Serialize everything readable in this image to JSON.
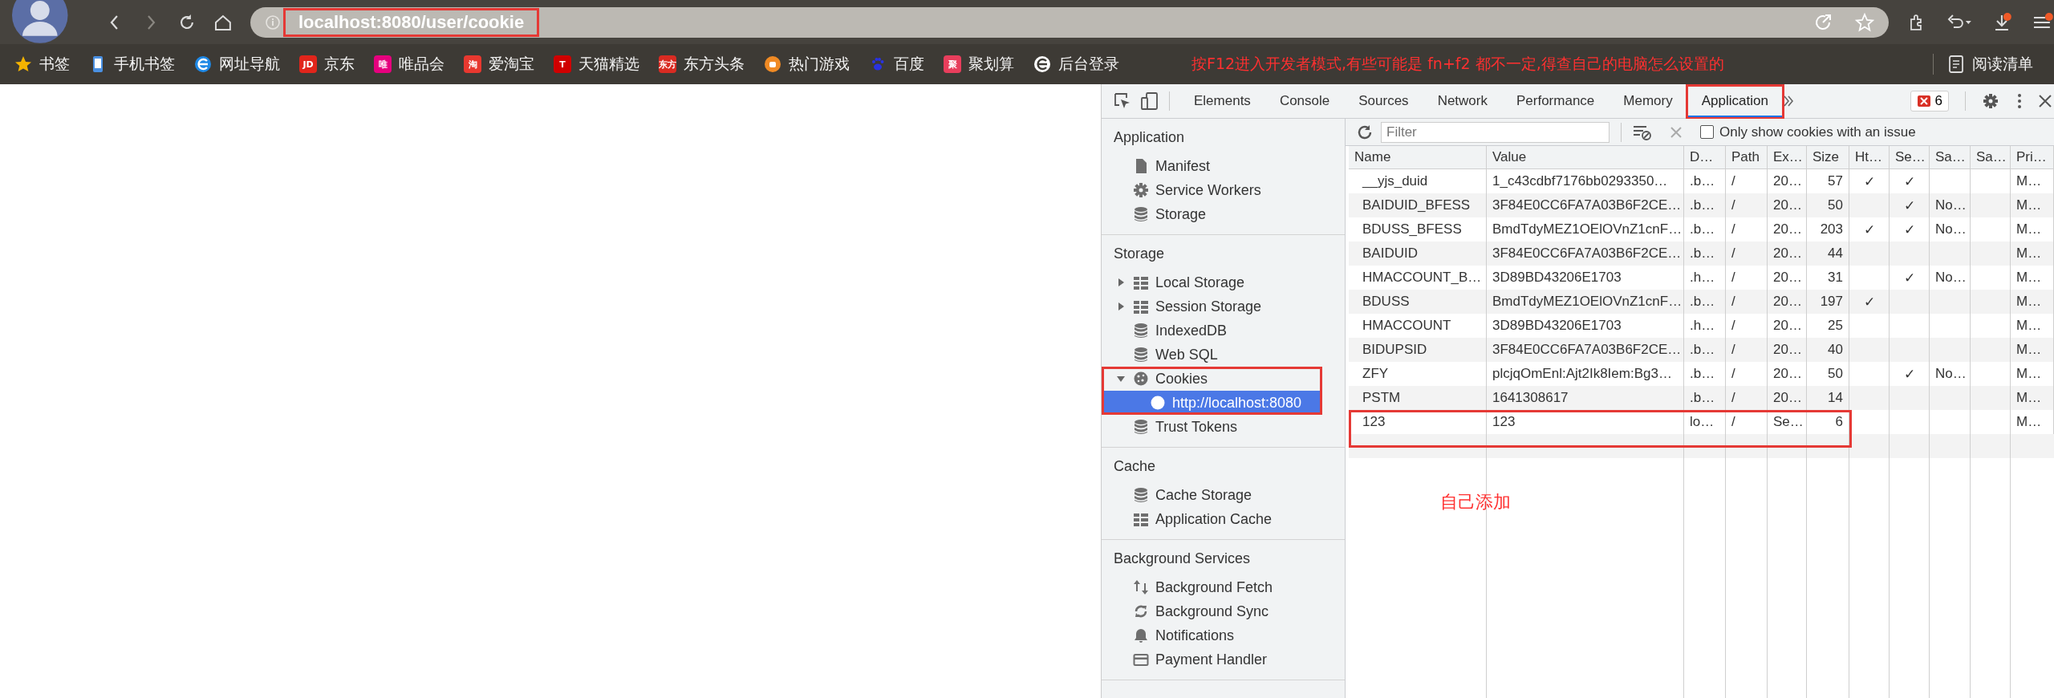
{
  "browser": {
    "url": "localhost:8080/user/cookie",
    "url_annotated": true,
    "bookmarks": [
      {
        "label": "书签",
        "kind": "star",
        "color": "#f5b400"
      },
      {
        "label": "手机书签",
        "kind": "phone",
        "color": "#4a90e2"
      },
      {
        "label": "网址导航",
        "kind": "globe",
        "color": "#1e88e5"
      },
      {
        "label": "京东",
        "kind": "text",
        "icon_text": "JD",
        "color": "#e1251b"
      },
      {
        "label": "唯品会",
        "kind": "text",
        "icon_text": "唯",
        "color": "#e6007e"
      },
      {
        "label": "爱淘宝",
        "kind": "text",
        "icon_text": "淘",
        "color": "#e8382f"
      },
      {
        "label": "天猫精选",
        "kind": "text",
        "icon_text": "T",
        "color": "#d00000"
      },
      {
        "label": "东方头条",
        "kind": "text",
        "icon_text": "东方",
        "color": "#d92b22"
      },
      {
        "label": "热门游戏",
        "kind": "circle",
        "color": "#f08a24"
      },
      {
        "label": "百度",
        "kind": "paw",
        "color": "#2932e1"
      },
      {
        "label": "聚划算",
        "kind": "text",
        "icon_text": "聚",
        "color": "#e83e5c"
      },
      {
        "label": "后台登录",
        "kind": "globe",
        "color": "#ffffff"
      }
    ],
    "annotation": "按F12进入开发者模式,有些可能是 fn+f2 都不一定,得查自己的电脑怎么设置的",
    "reading_list": "阅读清单"
  },
  "devtools": {
    "tabs": [
      {
        "label": "Elements",
        "selected": false,
        "annotated": false
      },
      {
        "label": "Console",
        "selected": false,
        "annotated": false
      },
      {
        "label": "Sources",
        "selected": false,
        "annotated": false
      },
      {
        "label": "Network",
        "selected": false,
        "annotated": false
      },
      {
        "label": "Performance",
        "selected": false,
        "annotated": false
      },
      {
        "label": "Memory",
        "selected": false,
        "annotated": false
      },
      {
        "label": "Application",
        "selected": true,
        "annotated": true
      }
    ],
    "error_count": "6",
    "sidebar": [
      {
        "title": "Application",
        "items": [
          {
            "label": "Manifest",
            "kind": "file",
            "selected": false
          },
          {
            "label": "Service Workers",
            "kind": "gear",
            "selected": false
          },
          {
            "label": "Storage",
            "kind": "db",
            "selected": false
          }
        ]
      },
      {
        "title": "Storage",
        "items": [
          {
            "label": "Local Storage",
            "kind": "table",
            "selected": false,
            "expanded": false
          },
          {
            "label": "Session Storage",
            "kind": "table",
            "selected": false,
            "expanded": false
          },
          {
            "label": "IndexedDB",
            "kind": "db",
            "selected": false
          },
          {
            "label": "Web SQL",
            "kind": "db",
            "selected": false
          },
          {
            "label": "Cookies",
            "kind": "cookie",
            "selected": false,
            "expanded": true,
            "annotated": true,
            "children": [
              {
                "label": "http://localhost:8080",
                "kind": "cookie",
                "selected": true
              }
            ]
          },
          {
            "label": "Trust Tokens",
            "kind": "db",
            "selected": false
          }
        ]
      },
      {
        "title": "Cache",
        "items": [
          {
            "label": "Cache Storage",
            "kind": "db",
            "selected": false
          },
          {
            "label": "Application Cache",
            "kind": "table",
            "selected": false
          }
        ]
      },
      {
        "title": "Background Services",
        "items": [
          {
            "label": "Background Fetch",
            "kind": "arrows",
            "selected": false
          },
          {
            "label": "Background Sync",
            "kind": "sync",
            "selected": false
          },
          {
            "label": "Notifications",
            "kind": "bell",
            "selected": false
          },
          {
            "label": "Payment Handler",
            "kind": "card",
            "selected": false
          }
        ]
      }
    ],
    "filter_placeholder": "Filter",
    "issue_filter": {
      "label": "Only show cookies with an issue",
      "checked": false
    },
    "table": {
      "columns": [
        "Name",
        "Value",
        "D…",
        "Path",
        "Ex…",
        "Size",
        "Ht…",
        "Se…",
        "Sa…",
        "Sa…",
        "Pri…"
      ],
      "rows": [
        {
          "cells": [
            "__yjs_duid",
            "1_c43cdbf7176bb0293350…",
            ".b…",
            "/",
            "20…",
            "57",
            "✓",
            "✓",
            null,
            null,
            "M…"
          ]
        },
        {
          "cells": [
            "BAIDUID_BFESS",
            "3F84E0CC6FA7A03B6F2CE…",
            ".b…",
            "/",
            "20…",
            "50",
            null,
            "✓",
            "No…",
            null,
            "M…"
          ]
        },
        {
          "cells": [
            "BDUSS_BFESS",
            "BmdTdyMEZ1OElOVnZ1cnF…",
            ".b…",
            "/",
            "20…",
            "203",
            "✓",
            "✓",
            "No…",
            null,
            "M…"
          ]
        },
        {
          "cells": [
            "BAIDUID",
            "3F84E0CC6FA7A03B6F2CE…",
            ".b…",
            "/",
            "20…",
            "44",
            null,
            null,
            null,
            null,
            "M…"
          ]
        },
        {
          "cells": [
            "HMACCOUNT_B…",
            "3D89BD43206E1703",
            ".h…",
            "/",
            "20…",
            "31",
            null,
            "✓",
            "No…",
            null,
            "M…"
          ]
        },
        {
          "cells": [
            "BDUSS",
            "BmdTdyMEZ1OElOVnZ1cnF…",
            ".b…",
            "/",
            "20…",
            "197",
            "✓",
            null,
            null,
            null,
            "M…"
          ]
        },
        {
          "cells": [
            "HMACCOUNT",
            "3D89BD43206E1703",
            ".h…",
            "/",
            "20…",
            "25",
            null,
            null,
            null,
            null,
            "M…"
          ]
        },
        {
          "cells": [
            "BIDUPSID",
            "3F84E0CC6FA7A03B6F2CE…",
            ".b…",
            "/",
            "20…",
            "40",
            null,
            null,
            null,
            null,
            "M…"
          ]
        },
        {
          "cells": [
            "ZFY",
            "plcjqOmEnl:Ajt2Ik8Iem:Bg3…",
            ".b…",
            "/",
            "20…",
            "50",
            null,
            "✓",
            "No…",
            null,
            "M…"
          ]
        },
        {
          "cells": [
            "PSTM",
            "1641308617",
            ".b…",
            "/",
            "20…",
            "14",
            null,
            null,
            null,
            null,
            "M…"
          ]
        },
        {
          "cells": [
            "123",
            "123",
            "lo…",
            "/",
            "Se…",
            "6",
            null,
            null,
            null,
            null,
            "M…"
          ],
          "annotated": true
        }
      ]
    },
    "table_note": "自己添加"
  }
}
